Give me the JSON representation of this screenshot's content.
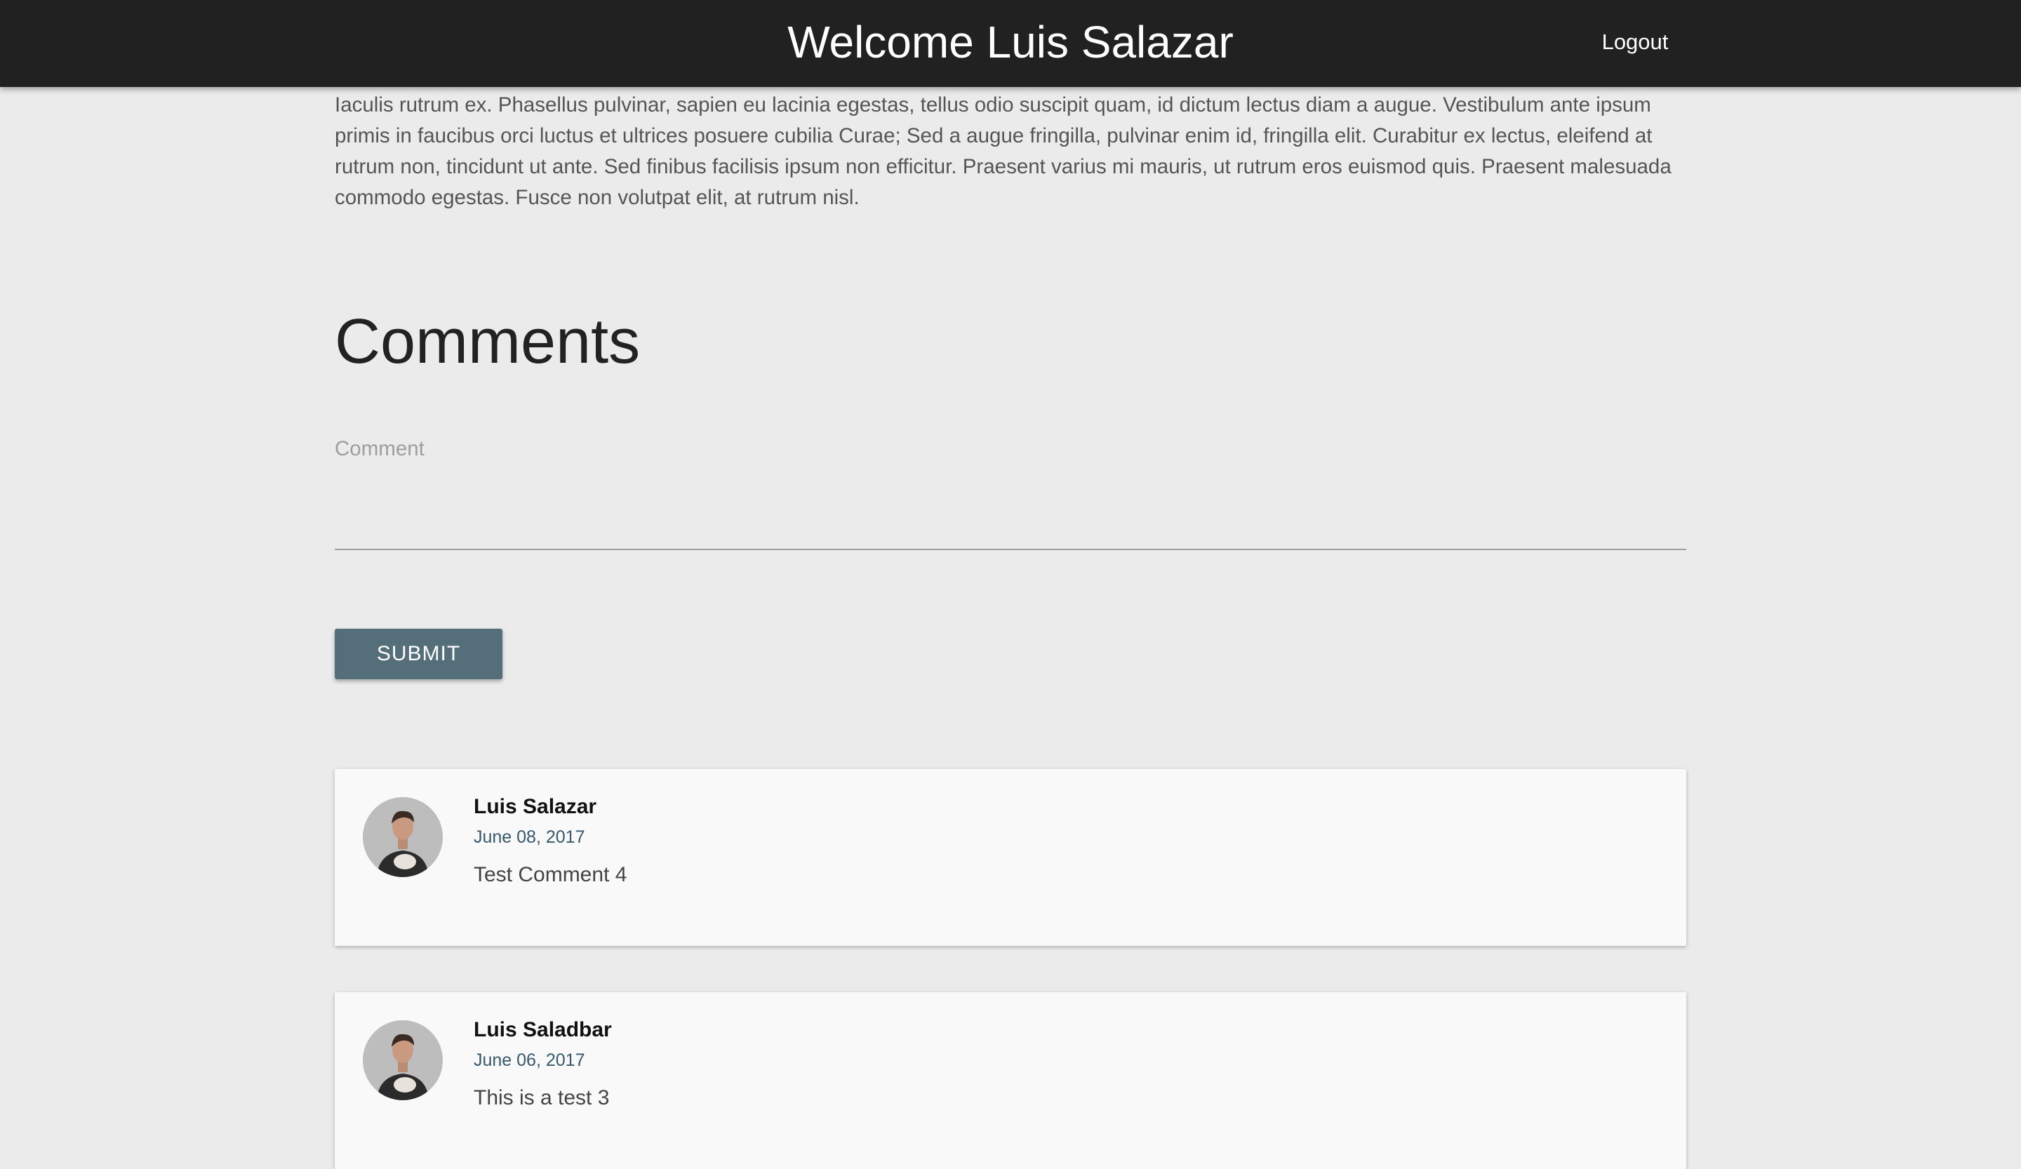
{
  "header": {
    "title": "Welcome Luis Salazar",
    "logout_label": "Logout"
  },
  "intro": {
    "text": "Iaculis rutrum ex. Phasellus pulvinar, sapien eu lacinia egestas, tellus odio suscipit quam, id dictum lectus diam a augue. Vestibulum ante ipsum primis in faucibus orci luctus et ultrices posuere cubilia Curae; Sed a augue fringilla, pulvinar enim id, fringilla elit. Curabitur ex lectus, eleifend at rutrum non, tincidunt ut ante. Sed finibus facilisis ipsum non efficitur. Praesent varius mi mauris, ut rutrum eros euismod quis. Praesent malesuada commodo egestas. Fusce non volutpat elit, at rutrum nisl."
  },
  "comments_section": {
    "heading": "Comments",
    "input_label": "Comment",
    "input_value": "",
    "submit_label": "SUBMIT"
  },
  "comments": [
    {
      "author": "Luis Salazar",
      "date": "June 08, 2017",
      "text": "Test Comment 4",
      "avatar_icon": "user-avatar-photo"
    },
    {
      "author": "Luis Saladbar",
      "date": "June 06, 2017",
      "text": "This is a test 3",
      "avatar_icon": "user-avatar-photo"
    }
  ],
  "colors": {
    "header_bg": "#212121",
    "page_bg": "#ebebeb",
    "button_bg": "#546e7a",
    "date_color": "#37596b",
    "card_bg": "#f9f9f9"
  }
}
